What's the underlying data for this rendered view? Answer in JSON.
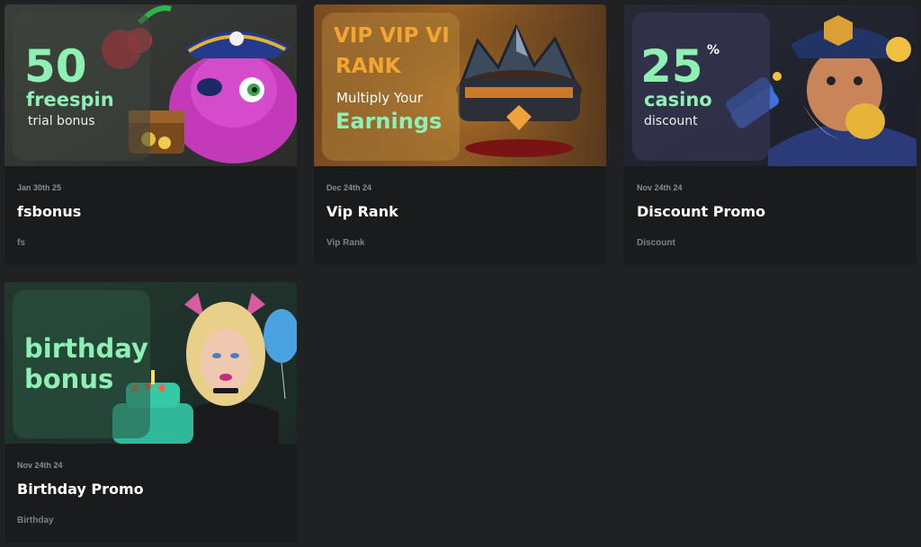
{
  "promotions": [
    {
      "banner": {
        "line1": "50",
        "line2": "freespin",
        "line3": "trial bonus"
      },
      "date": "Jan 30th 25",
      "title": "fsbonus",
      "tag": "fs"
    },
    {
      "banner": {
        "line1": "VIP VIP VI",
        "line2": "RANK",
        "line3": "Multiply Your",
        "line4": "Earnings"
      },
      "date": "Dec 24th 24",
      "title": "Vip Rank",
      "tag": "Vip Rank"
    },
    {
      "banner": {
        "line1": "25",
        "percent": "%",
        "line2": "casino",
        "line3": "discount"
      },
      "date": "Nov 24th 24",
      "title": "Discount Promo",
      "tag": "Discount"
    },
    {
      "banner": {
        "line1": "birthday",
        "line2": "bonus"
      },
      "date": "Nov 24th 24",
      "title": "Birthday Promo",
      "tag": "Birthday"
    }
  ],
  "colors": {
    "page_bg": "#202122",
    "card_bg": "#1a1b1c",
    "mint": "#8ff0b4",
    "vip_gold": "#f2a531"
  }
}
